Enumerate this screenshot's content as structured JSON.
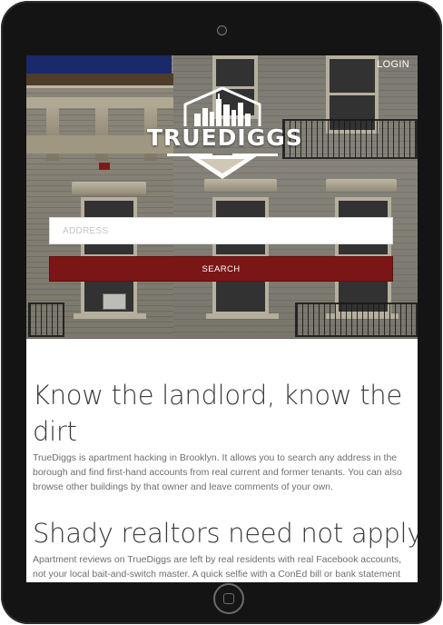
{
  "header": {
    "login_label": "LOGIN"
  },
  "brand": {
    "name": "TRUEDIGGS",
    "logo_icon": "city-skyline-shield-icon"
  },
  "search": {
    "address_placeholder": "ADDRESS",
    "address_value": "",
    "search_label": "SEARCH"
  },
  "sections": [
    {
      "heading": "Know the landlord, know the dirt",
      "body": "TrueDiggs is apartment hacking in Brooklyn. It allows you to search any address in the borough and find first-hand accounts from real current and former tenants. You can also browse other buildings by that owner and leave comments of your own."
    },
    {
      "heading": "Shady realtors need not apply",
      "body": "Apartment reviews on TrueDiggs are left by real residents with real Facebook accounts, not your local bait-and-switch master. A quick selfie with a ConEd bill or bank statement lets us"
    }
  ],
  "colors": {
    "accent": "#7a1616",
    "device": "#141414",
    "heading_text": "#3a3a3a",
    "body_text": "#6e6e6e"
  }
}
